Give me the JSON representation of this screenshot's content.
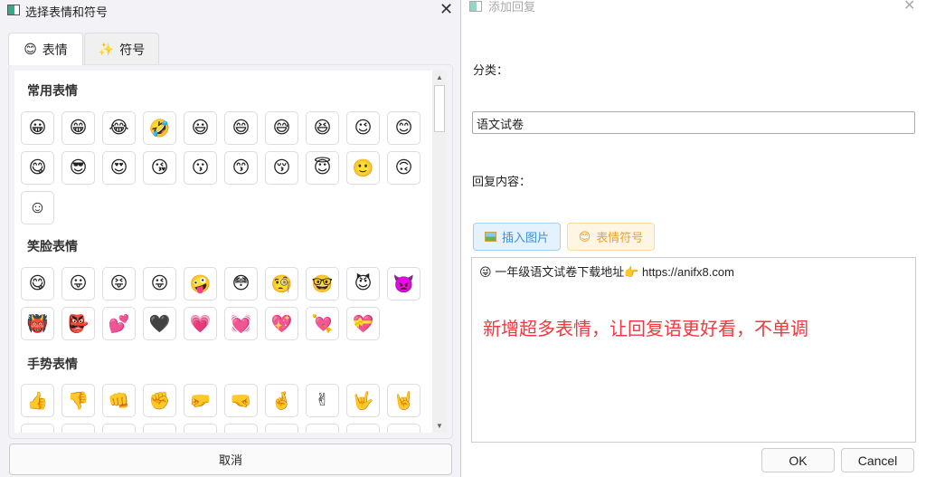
{
  "picker": {
    "title": "选择表情和符号",
    "tabs": [
      {
        "label": "表情",
        "icon": "😊"
      },
      {
        "label": "符号",
        "icon": "✨"
      }
    ],
    "sections": [
      {
        "title": "常用表情",
        "emojis": [
          "😀",
          "😁",
          "😂",
          "🤣",
          "😃",
          "😄",
          "😅",
          "😆",
          "😉",
          "😊",
          "😋",
          "😎",
          "😍",
          "😘",
          "😗",
          "😙",
          "😚",
          "😇",
          "🙂",
          "🙃",
          "☺"
        ]
      },
      {
        "title": "笑脸表情",
        "emojis": [
          "😋",
          "😛",
          "😝",
          "😜",
          "🤪",
          "😳",
          "🧐",
          "🤓",
          "😈",
          "👿",
          "👹",
          "👺",
          "💕",
          "🖤",
          "💗",
          "💓",
          "💖",
          "💘",
          "💝"
        ]
      },
      {
        "title": "手势表情",
        "emojis": [
          "👍",
          "👎",
          "👊",
          "✊",
          "🤛",
          "🤜",
          "🤞",
          "✌",
          "🤟",
          "🤘",
          "",
          "",
          "",
          "",
          "",
          "",
          "",
          "",
          "",
          ""
        ]
      }
    ],
    "cancel_label": "取消"
  },
  "reply": {
    "title": "添加回复",
    "category_label": "分类：",
    "category_value": "语文试卷",
    "content_label": "回复内容：",
    "insert_image_label": "插入图片",
    "emoji_button_label": "表情符号",
    "content_line1_emoji": "😜",
    "content_line1_text": "一年级语文试卷下载地址",
    "content_line1_pointer": "👉",
    "content_line1_url": "https://anifx8.com",
    "promo_text": "新增超多表情，让回复语更好看，不单调",
    "ok_label": "OK",
    "cancel_label": "Cancel"
  }
}
